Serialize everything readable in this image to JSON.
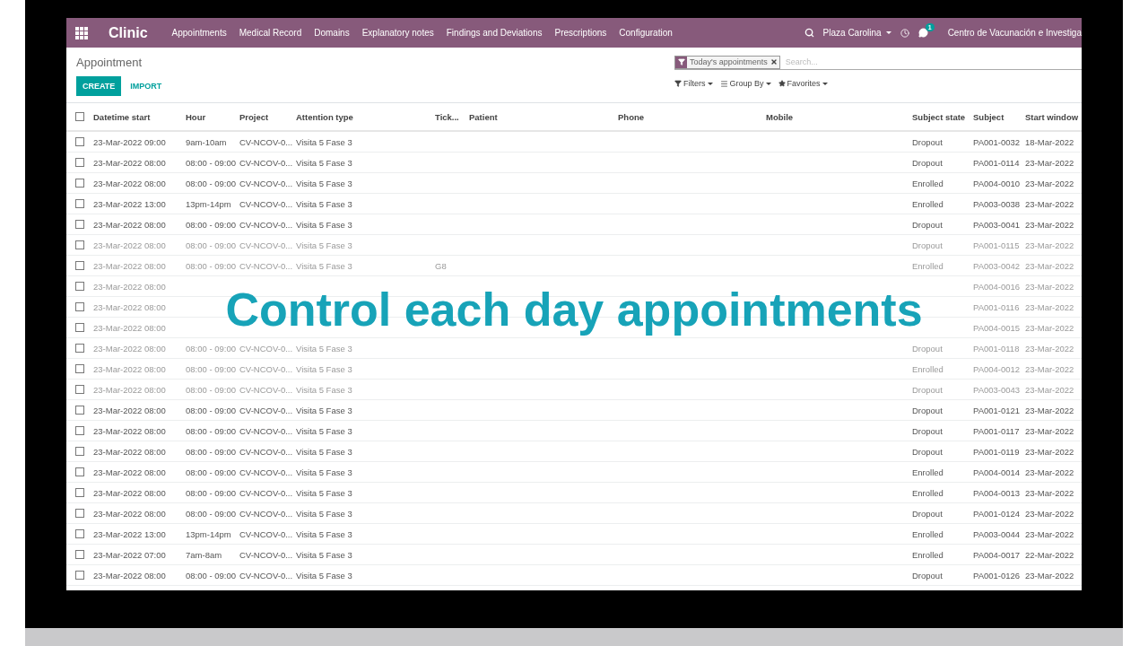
{
  "navbar": {
    "app_name": "Clinic",
    "menu": [
      "Appointments",
      "Medical Record",
      "Domains",
      "Explanatory notes",
      "Findings and Deviations",
      "Prescriptions",
      "Configuration"
    ],
    "company": "Plaza Carolina",
    "chat_badge": "1",
    "organization": "Centro de Vacunación e Investiga"
  },
  "control_panel": {
    "title": "Appointment",
    "facet": "Today's appointments",
    "search_placeholder": "Search...",
    "create": "CREATE",
    "import": "IMPORT",
    "filters": "Filters",
    "group_by": "Group By",
    "favorites": "Favorites"
  },
  "table": {
    "select_all_checked": false,
    "columns": [
      "Datetime start",
      "Hour",
      "Project",
      "Attention type",
      "Tick...",
      "Patient",
      "Phone",
      "Mobile",
      "Subject state",
      "Subject",
      "Start window"
    ],
    "rows": [
      {
        "checked": false,
        "faded": false,
        "datetime": "23-Mar-2022 09:00",
        "hour": "9am-10am",
        "project": "CV-NCOV-0...",
        "attention_type": "Visita 5 Fase 3",
        "subject_state": "Dropout",
        "subject": "PA001-0032",
        "start_window": "18-Mar-2022"
      },
      {
        "checked": false,
        "faded": false,
        "datetime": "23-Mar-2022 08:00",
        "hour": "08:00 - 09:00",
        "project": "CV-NCOV-0...",
        "attention_type": "Visita 5 Fase 3",
        "subject_state": "Dropout",
        "subject": "PA001-0114",
        "start_window": "23-Mar-2022"
      },
      {
        "checked": false,
        "faded": false,
        "datetime": "23-Mar-2022 08:00",
        "hour": "08:00 - 09:00",
        "project": "CV-NCOV-0...",
        "attention_type": "Visita 5 Fase 3",
        "subject_state": "Enrolled",
        "subject": "PA004-0010",
        "start_window": "23-Mar-2022"
      },
      {
        "checked": false,
        "faded": false,
        "datetime": "23-Mar-2022 13:00",
        "hour": "13pm-14pm",
        "project": "CV-NCOV-0...",
        "attention_type": "Visita 5 Fase 3",
        "subject_state": "Enrolled",
        "subject": "PA003-0038",
        "start_window": "23-Mar-2022"
      },
      {
        "checked": false,
        "faded": false,
        "datetime": "23-Mar-2022 08:00",
        "hour": "08:00 - 09:00",
        "project": "CV-NCOV-0...",
        "attention_type": "Visita 5 Fase 3",
        "subject_state": "Dropout",
        "subject": "PA003-0041",
        "start_window": "23-Mar-2022"
      },
      {
        "checked": false,
        "faded": true,
        "datetime": "23-Mar-2022 08:00",
        "hour": "08:00 - 09:00",
        "project": "CV-NCOV-0...",
        "attention_type": "Visita 5 Fase 3",
        "subject_state": "Dropout",
        "subject": "PA001-0115",
        "start_window": "23-Mar-2022"
      },
      {
        "checked": false,
        "faded": true,
        "datetime": "23-Mar-2022 08:00",
        "hour": "08:00 - 09:00",
        "project": "CV-NCOV-0...",
        "attention_type": "Visita 5 Fase 3",
        "ticket": "G8",
        "subject_state": "Enrolled",
        "subject": "PA003-0042",
        "start_window": "23-Mar-2022"
      },
      {
        "checked": false,
        "faded": true,
        "datetime": "23-Mar-2022 08:00",
        "subject": "PA004-0016",
        "start_window": "23-Mar-2022"
      },
      {
        "checked": false,
        "faded": true,
        "datetime": "23-Mar-2022 08:00",
        "subject": "PA001-0116",
        "start_window": "23-Mar-2022"
      },
      {
        "checked": false,
        "faded": true,
        "datetime": "23-Mar-2022 08:00",
        "subject": "PA004-0015",
        "start_window": "23-Mar-2022"
      },
      {
        "checked": false,
        "faded": true,
        "datetime": "23-Mar-2022 08:00",
        "hour": "08:00 - 09:00",
        "project": "CV-NCOV-0...",
        "attention_type": "Visita 5 Fase 3",
        "subject_state": "Dropout",
        "subject": "PA001-0118",
        "start_window": "23-Mar-2022"
      },
      {
        "checked": false,
        "faded": true,
        "datetime": "23-Mar-2022 08:00",
        "hour": "08:00 - 09:00",
        "project": "CV-NCOV-0...",
        "attention_type": "Visita 5 Fase 3",
        "subject_state": "Enrolled",
        "subject": "PA004-0012",
        "start_window": "23-Mar-2022"
      },
      {
        "checked": false,
        "faded": true,
        "datetime": "23-Mar-2022 08:00",
        "hour": "08:00 - 09:00",
        "project": "CV-NCOV-0...",
        "attention_type": "Visita 5 Fase 3",
        "subject_state": "Dropout",
        "subject": "PA003-0043",
        "start_window": "23-Mar-2022"
      },
      {
        "checked": false,
        "faded": false,
        "datetime": "23-Mar-2022 08:00",
        "hour": "08:00 - 09:00",
        "project": "CV-NCOV-0...",
        "attention_type": "Visita 5 Fase 3",
        "subject_state": "Dropout",
        "subject": "PA001-0121",
        "start_window": "23-Mar-2022"
      },
      {
        "checked": false,
        "faded": false,
        "datetime": "23-Mar-2022 08:00",
        "hour": "08:00 - 09:00",
        "project": "CV-NCOV-0...",
        "attention_type": "Visita 5 Fase 3",
        "subject_state": "Dropout",
        "subject": "PA001-0117",
        "start_window": "23-Mar-2022"
      },
      {
        "checked": false,
        "faded": false,
        "datetime": "23-Mar-2022 08:00",
        "hour": "08:00 - 09:00",
        "project": "CV-NCOV-0...",
        "attention_type": "Visita 5 Fase 3",
        "subject_state": "Dropout",
        "subject": "PA001-0119",
        "start_window": "23-Mar-2022"
      },
      {
        "checked": false,
        "faded": false,
        "datetime": "23-Mar-2022 08:00",
        "hour": "08:00 - 09:00",
        "project": "CV-NCOV-0...",
        "attention_type": "Visita 5 Fase 3",
        "subject_state": "Enrolled",
        "subject": "PA004-0014",
        "start_window": "23-Mar-2022"
      },
      {
        "checked": false,
        "faded": false,
        "datetime": "23-Mar-2022 08:00",
        "hour": "08:00 - 09:00",
        "project": "CV-NCOV-0...",
        "attention_type": "Visita 5 Fase 3",
        "subject_state": "Enrolled",
        "subject": "PA004-0013",
        "start_window": "23-Mar-2022"
      },
      {
        "checked": false,
        "faded": false,
        "datetime": "23-Mar-2022 08:00",
        "hour": "08:00 - 09:00",
        "project": "CV-NCOV-0...",
        "attention_type": "Visita 5 Fase 3",
        "subject_state": "Dropout",
        "subject": "PA001-0124",
        "start_window": "23-Mar-2022"
      },
      {
        "checked": false,
        "faded": false,
        "datetime": "23-Mar-2022 13:00",
        "hour": "13pm-14pm",
        "project": "CV-NCOV-0...",
        "attention_type": "Visita 5 Fase 3",
        "subject_state": "Enrolled",
        "subject": "PA003-0044",
        "start_window": "23-Mar-2022"
      },
      {
        "checked": false,
        "faded": false,
        "datetime": "23-Mar-2022 07:00",
        "hour": "7am-8am",
        "project": "CV-NCOV-0...",
        "attention_type": "Visita 5 Fase 3",
        "subject_state": "Enrolled",
        "subject": "PA004-0017",
        "start_window": "22-Mar-2022"
      },
      {
        "checked": false,
        "faded": false,
        "datetime": "23-Mar-2022 08:00",
        "hour": "08:00 - 09:00",
        "project": "CV-NCOV-0...",
        "attention_type": "Visita 5 Fase 3",
        "subject_state": "Dropout",
        "subject": "PA001-0126",
        "start_window": "23-Mar-2022"
      }
    ]
  },
  "caption": "Control each day appointments"
}
